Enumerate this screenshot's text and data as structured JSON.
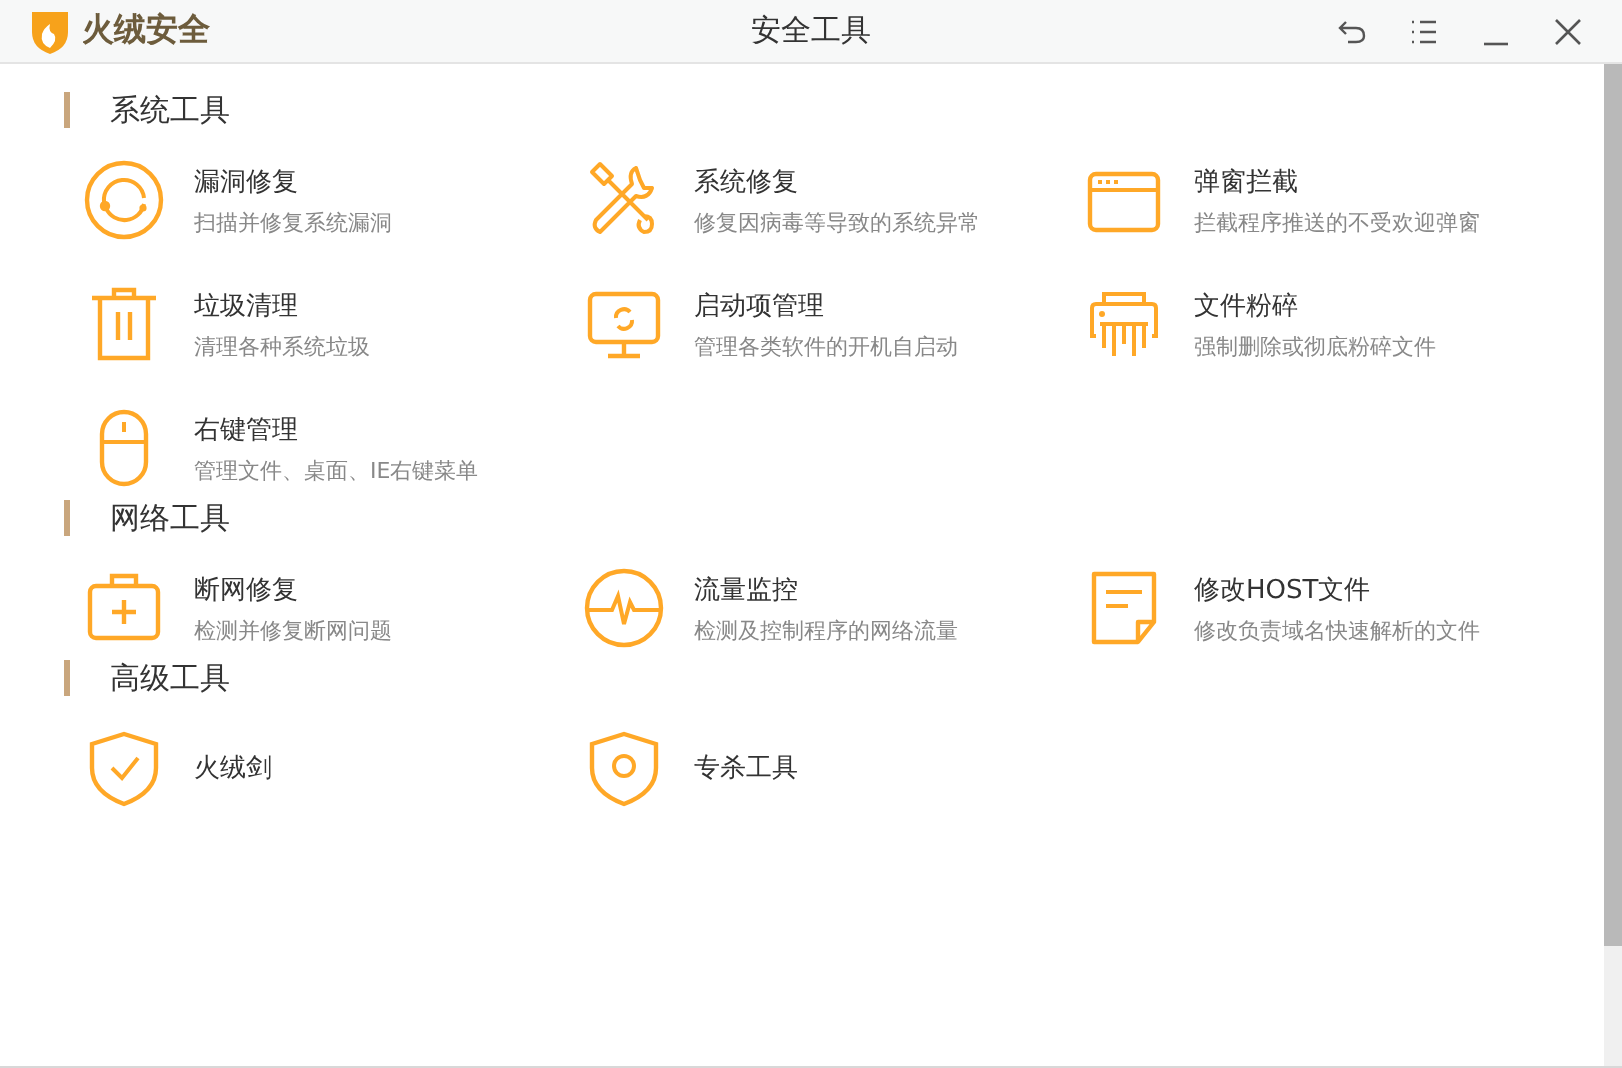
{
  "window": {
    "brand": "火绒安全",
    "title": "安全工具"
  },
  "sections": [
    {
      "title": "系统工具",
      "tools": [
        {
          "name": "漏洞修复",
          "desc": "扫描并修复系统漏洞"
        },
        {
          "name": "系统修复",
          "desc": "修复因病毒等导致的系统异常"
        },
        {
          "name": "弹窗拦截",
          "desc": "拦截程序推送的不受欢迎弹窗"
        },
        {
          "name": "垃圾清理",
          "desc": "清理各种系统垃圾"
        },
        {
          "name": "启动项管理",
          "desc": "管理各类软件的开机自启动"
        },
        {
          "name": "文件粉碎",
          "desc": "强制删除或彻底粉碎文件"
        },
        {
          "name": "右键管理",
          "desc": "管理文件、桌面、IE右键菜单"
        }
      ]
    },
    {
      "title": "网络工具",
      "tools": [
        {
          "name": "断网修复",
          "desc": "检测并修复断网问题"
        },
        {
          "name": "流量监控",
          "desc": "检测及控制程序的网络流量"
        },
        {
          "name": "修改HOST文件",
          "desc": "修改负责域名快速解析的文件"
        }
      ]
    },
    {
      "title": "高级工具",
      "tools": [
        {
          "name": "火绒剑"
        },
        {
          "name": "专杀工具"
        }
      ]
    }
  ]
}
